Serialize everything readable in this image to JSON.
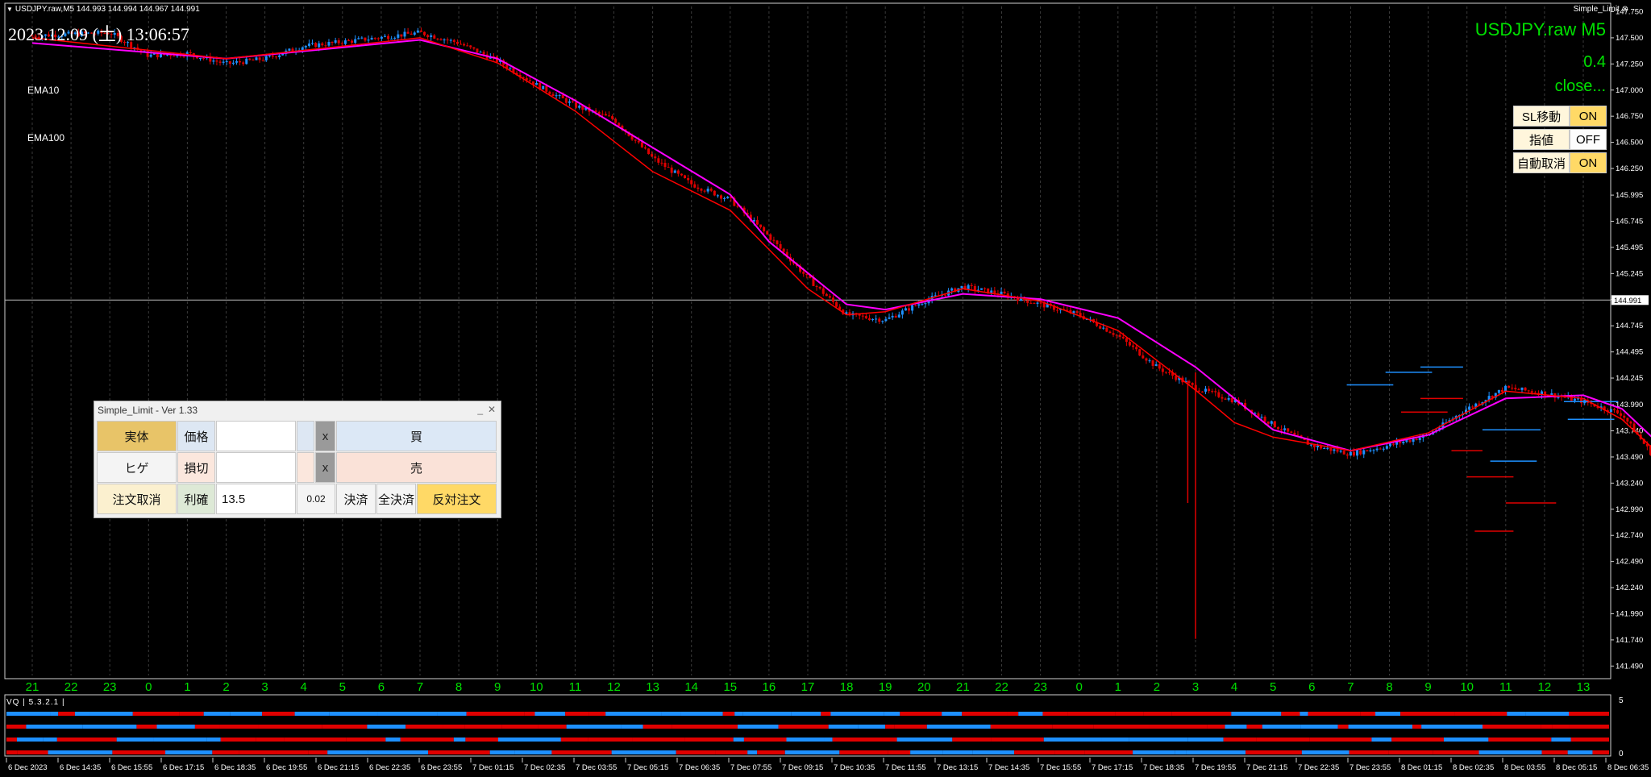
{
  "header": {
    "symbol_line": "USDJPY.raw,M5  144.993 144.994 144.967 144.991",
    "clock": "2023.12.09 (土) 13:06:57",
    "indicator_name": "Simple_Limit",
    "ema10_label": "EMA10",
    "ema100_label": "EMA100",
    "big_symbol": "USDJPY.raw  M5",
    "big_version": "0.4",
    "big_status": "close..."
  },
  "toggles": [
    {
      "name": "SL移動",
      "value": "ON"
    },
    {
      "name": "指値",
      "value": "OFF"
    },
    {
      "name": "自動取消",
      "value": "ON"
    }
  ],
  "panel": {
    "title": "Simple_Limit - Ver 1.33",
    "minimize": "_",
    "close": "✕",
    "row1": {
      "mode": "実体",
      "price_label": "価格",
      "price_value": "",
      "x": "x",
      "buy": "買"
    },
    "row2": {
      "mode": "ヒゲ",
      "sl_label": "損切",
      "sl_value": "",
      "x": "x",
      "sell": "売"
    },
    "row3": {
      "cancel": "注文取消",
      "tp_label": "利確",
      "tp_value": "13.5",
      "lot": "0.02",
      "settle": "決済",
      "settle_all": "全決済",
      "reverse": "反対注文"
    }
  },
  "subwindow": {
    "label": "VQ | 5.3.2.1 |",
    "scale_top": "5",
    "scale_bottom": "0"
  },
  "colors": {
    "background": "#000000",
    "bull": "#1e90ff",
    "bear": "#e00000",
    "ema10": "#ff0000",
    "ema100": "#ff00ff",
    "hour_labels": "#00e000",
    "grid": "#3a3a3a"
  },
  "chart_data": {
    "type": "candlestick",
    "symbol": "USDJPY.raw",
    "timeframe": "M5",
    "current_price": "144.991",
    "price_ticks": [
      "147.750",
      "147.500",
      "147.250",
      "147.000",
      "146.750",
      "146.500",
      "146.250",
      "145.995",
      "145.745",
      "145.495",
      "145.245",
      "144.995",
      "144.745",
      "144.495",
      "144.245",
      "143.990",
      "143.740",
      "143.490",
      "143.240",
      "142.990",
      "142.740",
      "142.490",
      "142.240",
      "141.990",
      "141.740",
      "141.490"
    ],
    "ylim": [
      141.4,
      147.8
    ],
    "hour_labels": [
      "21",
      "22",
      "23",
      "0",
      "1",
      "2",
      "3",
      "4",
      "5",
      "6",
      "7",
      "8",
      "9",
      "10",
      "11",
      "12",
      "13",
      "14",
      "15",
      "16",
      "17",
      "18",
      "19",
      "20",
      "21",
      "22",
      "23",
      "0",
      "1",
      "2",
      "3",
      "4",
      "5",
      "6",
      "7",
      "8",
      "9",
      "10",
      "11",
      "12",
      "13"
    ],
    "date_labels": [
      "6 Dec 2023",
      "6 Dec 14:35",
      "6 Dec 15:55",
      "6 Dec 17:15",
      "6 Dec 18:35",
      "6 Dec 19:55",
      "6 Dec 21:15",
      "6 Dec 22:35",
      "6 Dec 23:55",
      "7 Dec 01:15",
      "7 Dec 02:35",
      "7 Dec 03:55",
      "7 Dec 05:15",
      "7 Dec 06:35",
      "7 Dec 07:55",
      "7 Dec 09:15",
      "7 Dec 10:35",
      "7 Dec 11:55",
      "7 Dec 13:15",
      "7 Dec 14:35",
      "7 Dec 15:55",
      "7 Dec 17:15",
      "7 Dec 18:35",
      "7 Dec 19:55",
      "7 Dec 21:15",
      "7 Dec 22:35",
      "7 Dec 23:55",
      "8 Dec 01:15",
      "8 Dec 02:35",
      "8 Dec 03:55",
      "8 Dec 05:15",
      "8 Dec 06:35"
    ],
    "price_path": [
      [
        0,
        147.52
      ],
      [
        2,
        147.55
      ],
      [
        3,
        147.33
      ],
      [
        4,
        147.35
      ],
      [
        5,
        147.25
      ],
      [
        6,
        147.3
      ],
      [
        7,
        147.42
      ],
      [
        8,
        147.46
      ],
      [
        10,
        147.55
      ],
      [
        11,
        147.45
      ],
      [
        12,
        147.28
      ],
      [
        13,
        147.05
      ],
      [
        14,
        146.85
      ],
      [
        15,
        146.72
      ],
      [
        16,
        146.35
      ],
      [
        17,
        146.1
      ],
      [
        18,
        145.95
      ],
      [
        19,
        145.6
      ],
      [
        20,
        145.2
      ],
      [
        21,
        144.85
      ],
      [
        22,
        144.8
      ],
      [
        23,
        144.98
      ],
      [
        24,
        145.12
      ],
      [
        25,
        145.05
      ],
      [
        26,
        144.95
      ],
      [
        27,
        144.85
      ],
      [
        28,
        144.65
      ],
      [
        29,
        144.35
      ],
      [
        30,
        144.15
      ],
      [
        31,
        144.03
      ],
      [
        32,
        143.8
      ],
      [
        33,
        143.6
      ],
      [
        34,
        143.52
      ],
      [
        35,
        143.6
      ],
      [
        36,
        143.7
      ],
      [
        37,
        143.95
      ],
      [
        38,
        144.15
      ],
      [
        39,
        144.1
      ],
      [
        40,
        144.02
      ],
      [
        41,
        143.9
      ],
      [
        42,
        143.4
      ],
      [
        43,
        143.05
      ],
      [
        44,
        143.25
      ],
      [
        45,
        143.5
      ],
      [
        46,
        143.85
      ],
      [
        47,
        143.98
      ],
      [
        48,
        143.82
      ],
      [
        49,
        143.75
      ]
    ],
    "spikes": [
      {
        "pos": 30,
        "low": 141.75,
        "high": 144.3
      },
      {
        "pos": 29.8,
        "low": 143.05,
        "high": 144.22
      }
    ],
    "ema10_path": [
      [
        0,
        147.5
      ],
      [
        5,
        147.3
      ],
      [
        10,
        147.5
      ],
      [
        12,
        147.26
      ],
      [
        14,
        146.8
      ],
      [
        16,
        146.22
      ],
      [
        18,
        145.85
      ],
      [
        20,
        145.1
      ],
      [
        21,
        144.85
      ],
      [
        22,
        144.88
      ],
      [
        24,
        145.1
      ],
      [
        26,
        144.98
      ],
      [
        28,
        144.7
      ],
      [
        30,
        144.13
      ],
      [
        31,
        143.82
      ],
      [
        32,
        143.68
      ],
      [
        34,
        143.55
      ],
      [
        36,
        143.72
      ],
      [
        38,
        144.12
      ],
      [
        40,
        144.05
      ],
      [
        41,
        143.85
      ],
      [
        42,
        143.5
      ],
      [
        43,
        143.2
      ],
      [
        44,
        143.3
      ],
      [
        45,
        143.55
      ],
      [
        46,
        143.8
      ],
      [
        47,
        143.9
      ],
      [
        49,
        143.8
      ]
    ],
    "ema100_path": [
      [
        0,
        147.45
      ],
      [
        5,
        147.3
      ],
      [
        10,
        147.48
      ],
      [
        12,
        147.3
      ],
      [
        14,
        146.9
      ],
      [
        16,
        146.45
      ],
      [
        18,
        146.0
      ],
      [
        19,
        145.55
      ],
      [
        20,
        145.25
      ],
      [
        21,
        144.95
      ],
      [
        22,
        144.9
      ],
      [
        24,
        145.05
      ],
      [
        26,
        145.0
      ],
      [
        28,
        144.82
      ],
      [
        30,
        144.35
      ],
      [
        31,
        144.05
      ],
      [
        32,
        143.75
      ],
      [
        34,
        143.55
      ],
      [
        36,
        143.7
      ],
      [
        38,
        144.05
      ],
      [
        40,
        144.08
      ],
      [
        41,
        143.95
      ],
      [
        42,
        143.6
      ],
      [
        43,
        143.35
      ],
      [
        44,
        143.38
      ],
      [
        45,
        143.55
      ],
      [
        46,
        143.75
      ],
      [
        47,
        143.82
      ],
      [
        49,
        143.78
      ]
    ],
    "order_levels": [
      {
        "pos": 33.9,
        "len": 1.2,
        "price": 144.18,
        "color": "#1e90ff"
      },
      {
        "pos": 34.9,
        "len": 1.2,
        "price": 144.3,
        "color": "#1e90ff"
      },
      {
        "pos": 35.8,
        "len": 1.1,
        "price": 144.35,
        "color": "#1e90ff"
      },
      {
        "pos": 35.8,
        "len": 1.1,
        "price": 144.05,
        "color": "#e00000"
      },
      {
        "pos": 35.3,
        "len": 1.2,
        "price": 143.92,
        "color": "#e00000"
      },
      {
        "pos": 36.6,
        "len": 0.8,
        "price": 143.55,
        "color": "#e00000"
      },
      {
        "pos": 37.0,
        "len": 1.2,
        "price": 143.3,
        "color": "#e00000"
      },
      {
        "pos": 37.2,
        "len": 1.0,
        "price": 142.78,
        "color": "#e00000"
      },
      {
        "pos": 37.4,
        "len": 1.5,
        "price": 143.75,
        "color": "#1e90ff"
      },
      {
        "pos": 37.6,
        "len": 1.2,
        "price": 143.45,
        "color": "#1e90ff"
      },
      {
        "pos": 38.0,
        "len": 1.3,
        "price": 143.05,
        "color": "#e00000"
      },
      {
        "pos": 39.5,
        "len": 1.4,
        "price": 144.02,
        "color": "#1e90ff"
      },
      {
        "pos": 39.6,
        "len": 1.2,
        "price": 143.85,
        "color": "#1e90ff"
      }
    ]
  }
}
